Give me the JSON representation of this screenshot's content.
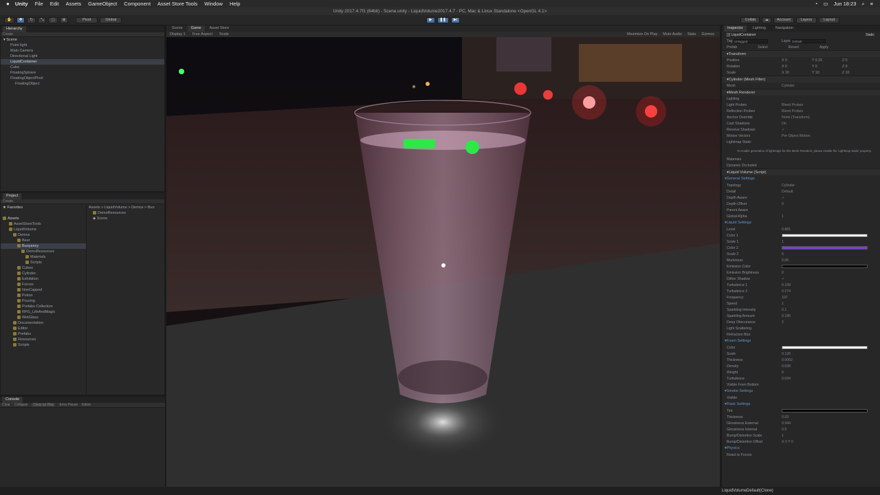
{
  "menubar": {
    "apple": "",
    "app": "Unity",
    "items": [
      "File",
      "Edit",
      "Assets",
      "GameObject",
      "Component",
      "Asset Store Tools",
      "Window",
      "Help"
    ],
    "clock": "Jun 18:23"
  },
  "title": "Unity 2017.4.7f1 (64bit) - Scene.unity - LiquidVolume2017.4.7 - PC, Mac & Linux Standalone <OpenGL 4.1>",
  "toolbar": {
    "pivot": "Pivot",
    "global": "Global",
    "collab": "Collab",
    "account": "Account",
    "layers": "Layers",
    "layout": "Layout"
  },
  "hierarchy": {
    "tab": "Hierarchy",
    "create": "Create",
    "scene": "Scene",
    "items": [
      "Point light",
      "Main Camera",
      "Directional Light",
      "LiquidContainer",
      "Cube",
      "FloatingSphere",
      "FloatingObjectPivot",
      "FloatingObject"
    ]
  },
  "project": {
    "tab": "Project",
    "create": "Create",
    "favorites": "Favorites",
    "assets": "Assets",
    "tree": [
      "AssetStoreTools",
      "LiquidVolume",
      "Demos",
      "Beer",
      "Buoyancy",
      "DemoResources",
      "Materials",
      "Scripts",
      "Cubes",
      "Cylinder",
      "Exhibition",
      "Forces",
      "NonCapped",
      "Potion",
      "Pouring",
      "Prefabs Collection",
      "RPG_LifeAndMagic",
      "WetGlass",
      "Documentation",
      "Editor",
      "Prefabs",
      "Resources",
      "Scripts"
    ],
    "path": "Assets > LiquidVolume > Demos > Buo",
    "files": [
      "DemoResources",
      "Scene"
    ]
  },
  "console": {
    "tab": "Console",
    "buttons": [
      "Clear",
      "Collapse",
      "Clear on Play",
      "Error Pause",
      "Editor"
    ]
  },
  "viewTabs": {
    "scene": "Scene",
    "game": "Game",
    "store": "Asset Store",
    "display": "Display 1",
    "aspect": "Free Aspect",
    "scale": "Scale",
    "maximize": "Maximize On Play",
    "mute": "Mute Audio",
    "stats": "Stats",
    "gizmos": "Gizmos"
  },
  "inspector": {
    "tabs": [
      "Inspector",
      "Lighting",
      "Navigation"
    ],
    "name": "LiquidContainer",
    "static": "Static",
    "tag": "Untagged",
    "layer": "Default",
    "transform": {
      "title": "Transform",
      "rows": [
        [
          "Position",
          "X 0",
          "Y 0.15",
          "Z 0"
        ],
        [
          "Rotation",
          "X 0",
          "Y 0",
          "Z 0"
        ],
        [
          "Scale",
          "X 10",
          "Y 10",
          "Z 10"
        ]
      ]
    },
    "meshfilter": {
      "title": "Cylinder (Mesh Filter)",
      "mesh": "Mesh",
      "value": "Cylinder"
    },
    "renderer": {
      "title": "Mesh Renderer",
      "rows": [
        [
          "Lighting",
          ""
        ],
        [
          "Light Probes",
          "Blend Probes"
        ],
        [
          "Reflection Probes",
          "Blend Probes"
        ],
        [
          "Anchor Override",
          "None (Transform)"
        ],
        [
          "Cast Shadows",
          "On"
        ],
        [
          "Receive Shadows",
          "✓"
        ],
        [
          "Motion Vectors",
          "Per Object Motion"
        ],
        [
          "Lightmap Static",
          ""
        ]
      ],
      "note": "To enable generation of lightmaps for this Mesh Renderer, please enable the 'Lightmap Static' property.",
      "materials": "Materials",
      "occluded": "Dynamic Occluded"
    },
    "liquid": {
      "title": "Liquid Volume (Script)",
      "general": "General Settings",
      "genrows": [
        [
          "Topology",
          "Cylinder"
        ],
        [
          "Detail",
          "Default"
        ],
        [
          "Depth Aware",
          "✓"
        ],
        [
          "Depth Offset",
          "0"
        ],
        [
          "Parent Aware",
          ""
        ],
        [
          "Global Alpha",
          "1"
        ]
      ],
      "liqhead": "Liquid Settings",
      "liqrows": [
        [
          "Level",
          "0.881"
        ],
        [
          "Color 1",
          ""
        ],
        [
          "Scale 1",
          "1"
        ],
        [
          "Color 2",
          ""
        ],
        [
          "Scale 2",
          "5"
        ],
        [
          "Murkiness",
          "0.06"
        ],
        [
          "Emission Color",
          ""
        ],
        [
          "Emission Brightness",
          "0"
        ],
        [
          "Dither Shadow",
          "✓"
        ],
        [
          "Turbulence 1",
          "0.158"
        ],
        [
          "Turbulence 2",
          "0.274"
        ],
        [
          "Frequency",
          "107"
        ],
        [
          "Speed",
          "1"
        ],
        [
          "Sparkling Intensity",
          "0.1"
        ],
        [
          "Sparkling Amount",
          "0.185"
        ],
        [
          "Deep Obscurance",
          "2"
        ],
        [
          "Light Scattering",
          ""
        ],
        [
          "Refraction Blur",
          ""
        ]
      ],
      "foamhead": "Foam Settings",
      "foamrows": [
        [
          "Color",
          ""
        ],
        [
          "Scale",
          "0.126"
        ],
        [
          "Thickness",
          "0.0002"
        ],
        [
          "Density",
          "0.038"
        ],
        [
          "Weight",
          "6"
        ],
        [
          "Turbulence",
          "0.034"
        ],
        [
          "Visible From Bottom",
          ""
        ]
      ],
      "smokehead": "Smoke Settings",
      "smokerows": [
        [
          "Visible",
          ""
        ]
      ],
      "flaskhead": "Flask Settings",
      "flaskrows": [
        [
          "Tint",
          ""
        ],
        [
          "Thickness",
          "0.03"
        ],
        [
          "Glossiness External",
          "0.944"
        ],
        [
          "Glossiness Internal",
          "0.5"
        ],
        [
          "Bump/Distortion Scale",
          "1"
        ],
        [
          "Bump/Distortion Offset",
          "X 0   Y 0"
        ]
      ],
      "physhead": "Physics",
      "physrows": [
        [
          "React to Forces",
          ""
        ]
      ]
    },
    "help": "Help",
    "select": "Select",
    "revert": "Revert",
    "apply": "Apply",
    "prefab": "Prefab"
  },
  "status": "LiquidVolumeDefault(Clone)",
  "colors": {
    "color1": "#f0f0f0",
    "color2": "#7a3fd6",
    "foam": "#ffffff",
    "emission": "#000000",
    "tint": "#000000"
  }
}
